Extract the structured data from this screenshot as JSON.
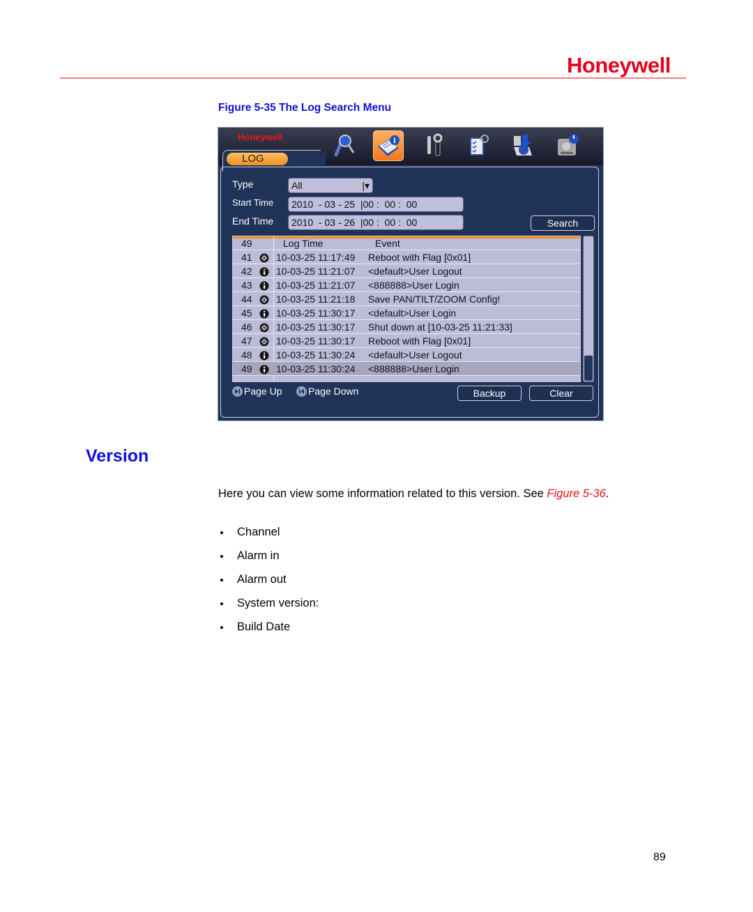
{
  "header": {
    "brand": "Honeywell"
  },
  "figure": {
    "caption": "Figure 5-35 The Log Search Menu",
    "dvr": {
      "brand": "Honeywell",
      "active_tab": "LOG",
      "toolbar_icons": [
        "search-icon",
        "info-book-icon",
        "tools-icon",
        "checklist-icon",
        "backup-disc-icon",
        "hdd-power-icon"
      ],
      "form": {
        "type_label": "Type",
        "type_value": "All",
        "start_label": "Start Time",
        "start_value": "2010  - 03 - 25  |00 :  00 :  00",
        "end_label": "End Time",
        "end_value": "2010  - 03 - 26  |00 :  00 :  00",
        "search_button": "Search"
      },
      "table": {
        "headers": {
          "count": "49",
          "time": "Log Time",
          "event": "Event"
        },
        "rows": [
          {
            "no": "41",
            "icon": "system",
            "time": "10-03-25 11:17:49",
            "event": "Reboot with Flag [0x01]"
          },
          {
            "no": "42",
            "icon": "info",
            "time": "10-03-25 11:21:07",
            "event": "<default>User Logout"
          },
          {
            "no": "43",
            "icon": "info",
            "time": "10-03-25 11:21:07",
            "event": "<888888>User Login"
          },
          {
            "no": "44",
            "icon": "system",
            "time": "10-03-25 11:21:18",
            "event": "Save PAN/TILT/ZOOM Config!"
          },
          {
            "no": "45",
            "icon": "info",
            "time": "10-03-25 11:30:17",
            "event": "<default>User Login"
          },
          {
            "no": "46",
            "icon": "system",
            "time": "10-03-25 11:30:17",
            "event": "Shut down at [10-03-25 11:21:33]"
          },
          {
            "no": "47",
            "icon": "system",
            "time": "10-03-25 11:30:17",
            "event": "Reboot with Flag [0x01]"
          },
          {
            "no": "48",
            "icon": "info",
            "time": "10-03-25 11:30:24",
            "event": "<default>User Logout"
          },
          {
            "no": "49",
            "icon": "info",
            "time": "10-03-25 11:30:24",
            "event": "<888888>User Login",
            "selected": true
          }
        ]
      },
      "footer": {
        "page_up": "Page Up",
        "page_down": "Page Down",
        "backup": "Backup",
        "clear": "Clear"
      }
    }
  },
  "section": {
    "title": "Version",
    "para_text": "Here you can view some information related to this version. See ",
    "para_ref": "Figure 5-36",
    "para_end": ".",
    "bullets": [
      "Channel",
      "Alarm in",
      "Alarm out",
      "System version:",
      "Build Date"
    ]
  },
  "page_number": "89",
  "colors": {
    "brand_red": "#e8001c",
    "heading_blue": "#1010e0",
    "dvr_bg": "#1f3358",
    "accent_orange": "#f09020"
  }
}
